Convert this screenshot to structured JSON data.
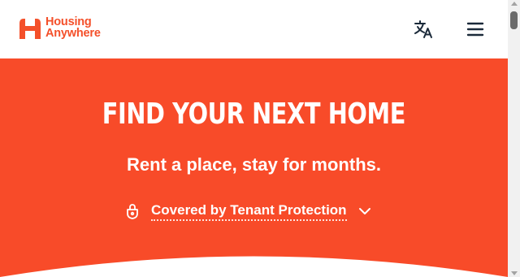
{
  "brand": {
    "name_line1": "Housing",
    "name_line2": "Anywhere",
    "color": "#f4502a"
  },
  "header": {
    "language_icon": "translate-icon",
    "menu_icon": "hamburger-menu-icon"
  },
  "hero": {
    "title": "FIND YOUR NEXT HOME",
    "subtitle": "Rent a place, stay for months.",
    "protection_label": "Covered by Tenant Protection",
    "protection_icon": "shield-lock-icon",
    "expand_icon": "chevron-down-icon",
    "background_color": "#f84b29"
  }
}
